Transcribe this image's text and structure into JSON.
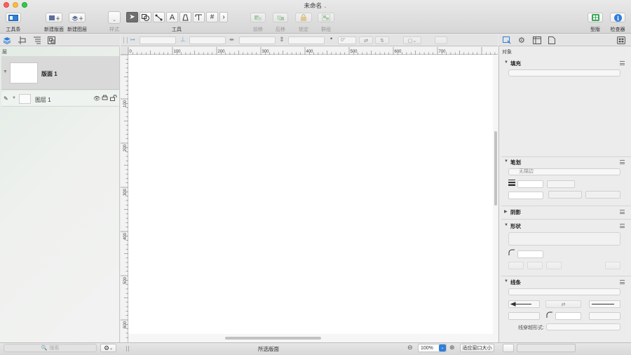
{
  "window": {
    "title": "未命名"
  },
  "toolbar": {
    "toolbar_label": "工具条",
    "new_canvas_label": "新建版面",
    "new_layer_label": "新建图层",
    "style_label": "样式",
    "tools_label": "工具",
    "forward_label": "前移",
    "backward_label": "后移",
    "lock_label": "锁定",
    "group_label": "群组",
    "layout_label": "型版",
    "inspector_label": "检查器"
  },
  "sidebar": {
    "header": "层",
    "canvas_name": "版面 1",
    "layer_name": "图层 1"
  },
  "ruler": {
    "h_ticks": [
      "0",
      "100",
      "200",
      "300",
      "400",
      "500",
      "600",
      "700"
    ],
    "v_ticks": [
      "100",
      "200",
      "300",
      "400",
      "500",
      "600"
    ]
  },
  "subbar": {
    "rotation_value": "0°"
  },
  "inspector": {
    "header": "对象",
    "fill_title": "填充",
    "stroke_title": "笔划",
    "stroke_none": "无描边",
    "shadow_title": "阴影",
    "shape_title": "形状",
    "lines_title": "线条",
    "line_hop_label": "线穿越形式:"
  },
  "bottom": {
    "search_placeholder": "搜索",
    "selection_label": "所选版面",
    "zoom_value": "100%",
    "fit_window_label": "适应窗口大小"
  },
  "colors": {
    "accent": "#2f7fd8",
    "close": "#fc605c",
    "minimize": "#fdbc40",
    "zoom": "#34c84a",
    "layout_icon": "#3aa757"
  }
}
